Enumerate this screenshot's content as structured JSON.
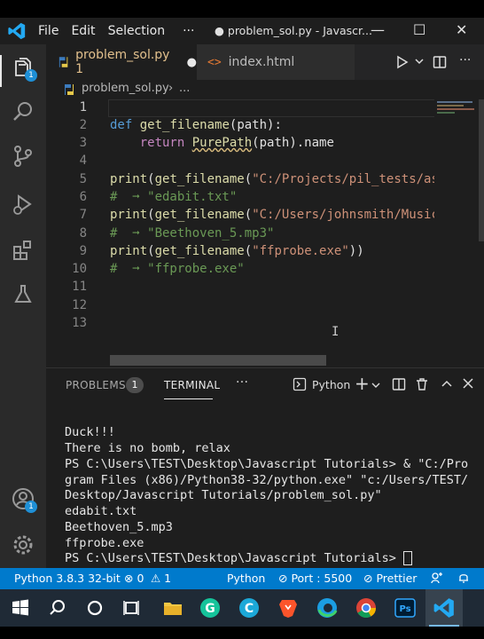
{
  "titlebar": {
    "menus": [
      "File",
      "Edit",
      "Selection",
      "···"
    ],
    "title": "● problem_sol.py - Javascr...",
    "buttons": [
      "—",
      "☐",
      "✕"
    ]
  },
  "activity": {
    "explorer_badge": "1",
    "account_badge": "1"
  },
  "tabs": [
    {
      "label": "problem_sol.py 1",
      "modified": "●",
      "active": true
    },
    {
      "label": "index.html",
      "icon": "<>",
      "active": false
    }
  ],
  "breadcrumb": {
    "file": "problem_sol.py",
    "sep": "›",
    "rest": "..."
  },
  "editor": {
    "line_numbers": [
      "1",
      "2",
      "3",
      "4",
      "5",
      "6",
      "7",
      "8",
      "9",
      "10",
      "11",
      "12",
      "13"
    ],
    "lines": {
      "l2": [
        "def",
        " get_filename",
        "(",
        "path",
        "):"
      ],
      "l3": [
        "    return ",
        "PurePath",
        "(",
        "path",
        ").",
        "name"
      ],
      "l5": [
        "print",
        "(",
        "get_filename",
        "(",
        "\"C:/Projects/pil_tests/as"
      ],
      "l6": "#  ➞ \"edabit.txt\"",
      "l7": [
        "print",
        "(",
        "get_filename",
        "(",
        "\"C:/Users/johnsmith/Music"
      ],
      "l8": "#  ➞ \"Beethoven_5.mp3\"",
      "l9": [
        "print",
        "(",
        "get_filename",
        "(",
        "\"ffprobe.exe\"",
        "))"
      ],
      "l10": "#  ➞ \"ffprobe.exe\""
    }
  },
  "panel": {
    "tabs": {
      "problems": "PROBLEMS",
      "problems_count": "1",
      "terminal": "TERMINAL",
      "more": "···"
    },
    "shell": "Python",
    "terminal_lines": [
      "Duck!!!",
      "There is no bomb, relax",
      "PS C:\\Users\\TEST\\Desktop\\Javascript Tutorials> & \"C:/Pro",
      "gram Files (x86)/Python38-32/python.exe\" \"c:/Users/TEST/",
      "Desktop/Javascript Tutorials/problem_sol.py\"",
      "edabit.txt",
      "Beethoven_5.mp3",
      "ffprobe.exe",
      "PS C:\\Users\\TEST\\Desktop\\Javascript Tutorials> "
    ]
  },
  "statusbar": {
    "python": "Python 3.8.3 32-bit",
    "errors": "⊗ 0",
    "warnings": "⚠ 1",
    "language": "Python",
    "port": "⊘ Port : 5500",
    "prettier": "⊘ Prettier"
  },
  "colors": {
    "accent": "#007acc",
    "string": "#ce9178",
    "keyword": "#569cd6",
    "function": "#dcdcaa",
    "comment": "#6a9955"
  }
}
